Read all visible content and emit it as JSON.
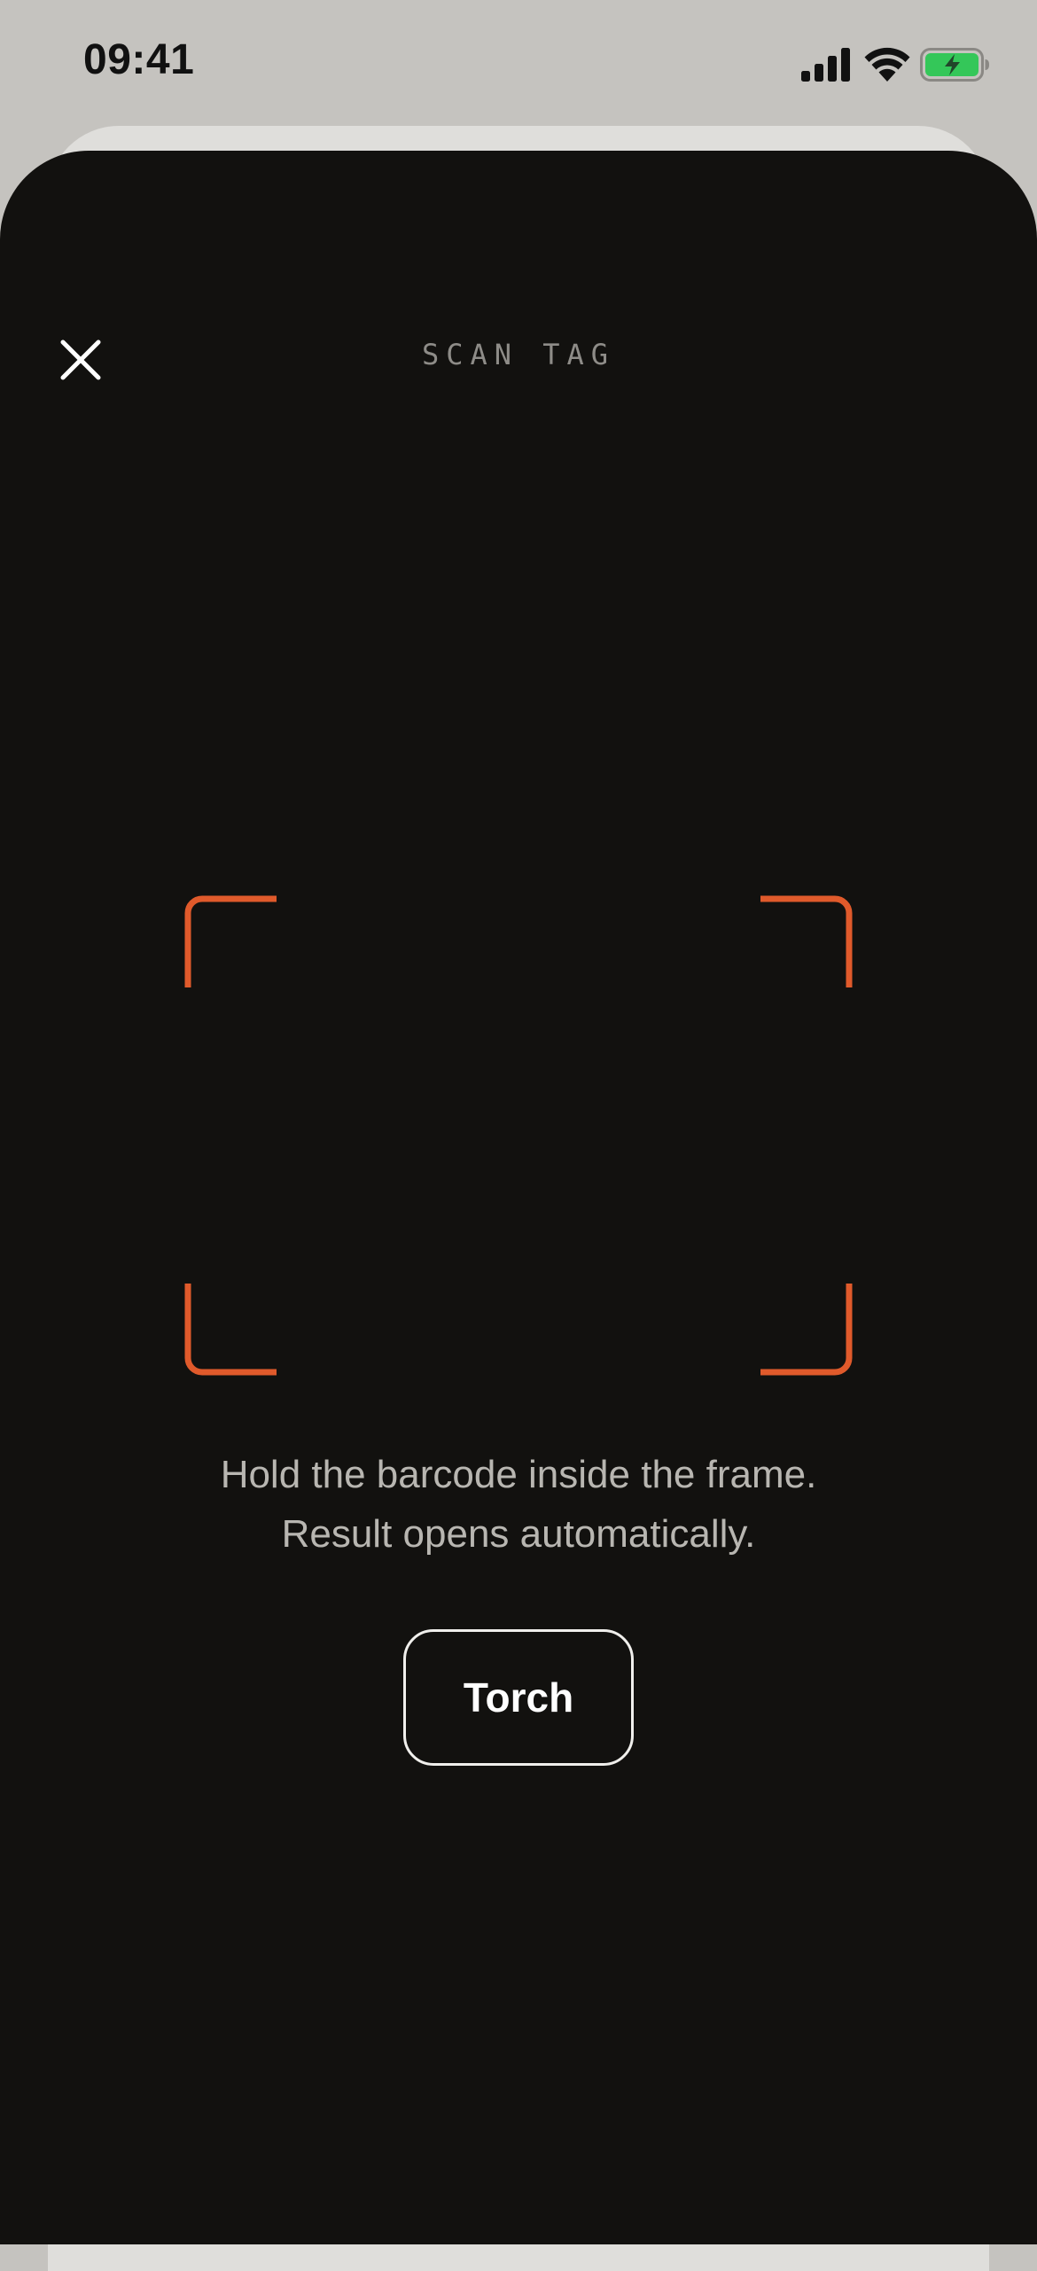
{
  "status_bar": {
    "time": "09:41",
    "icons": [
      "cellular-signal-icon",
      "wifi-icon",
      "battery-charging-icon"
    ]
  },
  "header": {
    "title": "SCAN TAG",
    "close_icon": "close-icon"
  },
  "scanner": {
    "instruction_line_1": "Hold the barcode inside the frame.",
    "instruction_line_2": "Result opens automatically."
  },
  "actions": {
    "torch_label": "Torch"
  },
  "colors": {
    "background": "#c5c3bf",
    "sheet": "#12110f",
    "accent": "#e05a2b",
    "battery_fill": "#34c759",
    "text_muted": "#b8b6b1"
  }
}
